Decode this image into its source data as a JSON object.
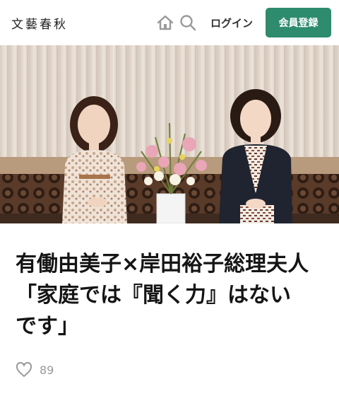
{
  "header": {
    "logo_text": "文藝春秋",
    "home_icon": "home-icon",
    "search_icon": "search-icon",
    "login_label": "ログイン",
    "signup_label": "会員登録",
    "brand_color": "#2e8b6e"
  },
  "hero": {
    "image": "photo"
  },
  "article": {
    "title_lines": [
      "有働由美子×岸田裕子総理夫人",
      "「家庭では『聞く力』はない",
      "です」"
    ],
    "like_icon": "heart-icon",
    "like_count": "89"
  }
}
